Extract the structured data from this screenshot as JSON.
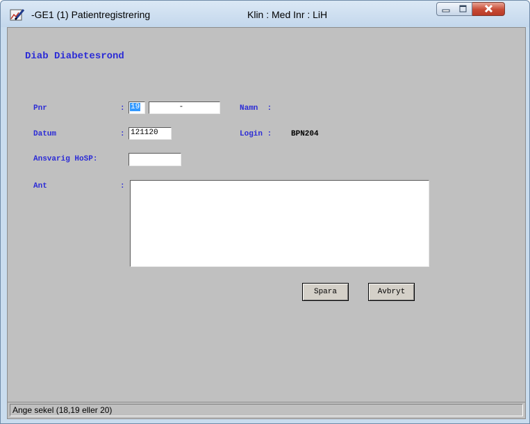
{
  "window": {
    "title": "-GE1 (1) Patientregistrering",
    "title_right": "Klin : Med  Inr : LiH",
    "app_icon": "pen-chart-icon"
  },
  "form": {
    "heading": "Diab Diabetesrond",
    "pnr_label": "Pnr",
    "pnr_colon": ":",
    "pnr_century": "19",
    "pnr_rest": "      -",
    "namn_label": "Namn  :",
    "datum_label": "Datum",
    "datum_colon": ":",
    "datum_value": "121120",
    "login_label": "Login : ",
    "login_value": "BPN204",
    "ansvarig_label": "Ansvarig HoSP:",
    "ansvarig_value": "",
    "ant_label": "Ant",
    "ant_colon": ":",
    "ant_value": ""
  },
  "buttons": {
    "spara": "Spara",
    "avbryt": "Avbryt"
  },
  "statusbar": {
    "text": "Ange sekel (18,19 eller 20)"
  }
}
